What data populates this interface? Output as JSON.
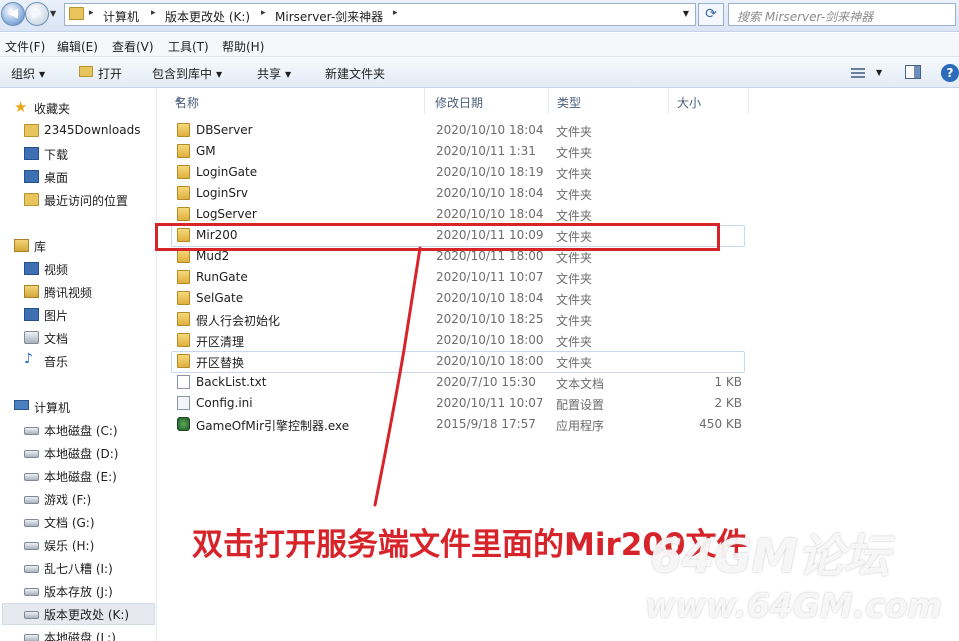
{
  "address_bar": {
    "crumbs": [
      "计算机",
      "版本更改处 (K:)",
      "Mirserver-剑来神器"
    ],
    "search_placeholder": "搜索 Mirserver-剑来神器"
  },
  "menu": {
    "items": [
      "文件(F)",
      "编辑(E)",
      "查看(V)",
      "工具(T)",
      "帮助(H)"
    ]
  },
  "toolbar": {
    "organize": "组织",
    "open": "打开",
    "include_library": "包含到库中",
    "share": "共享",
    "new_folder": "新建文件夹"
  },
  "nav": {
    "favorites_header": "收藏夹",
    "favorites": [
      "2345Downloads",
      "下载",
      "桌面",
      "最近访问的位置"
    ],
    "libraries_header": "库",
    "libraries": [
      "视频",
      "腾讯视频",
      "图片",
      "文档",
      "音乐"
    ],
    "computer_header": "计算机",
    "drives": [
      "本地磁盘 (C:)",
      "本地磁盘 (D:)",
      "本地磁盘 (E:)",
      "游戏 (F:)",
      "文档 (G:)",
      "娱乐 (H:)",
      "乱七八糟 (I:)",
      "版本存放 (J:)",
      "版本更改处 (K:)",
      "本地磁盘 (L:)"
    ]
  },
  "columns": {
    "name": "名称",
    "modified": "修改日期",
    "type": "类型",
    "size": "大小"
  },
  "files": [
    {
      "name": "DBServer",
      "date": "2020/10/10 18:04",
      "type": "文件夹",
      "size": "",
      "kind": "folder"
    },
    {
      "name": "GM",
      "date": "2020/10/11 1:31",
      "type": "文件夹",
      "size": "",
      "kind": "folder"
    },
    {
      "name": "LoginGate",
      "date": "2020/10/10 18:19",
      "type": "文件夹",
      "size": "",
      "kind": "folder"
    },
    {
      "name": "LoginSrv",
      "date": "2020/10/10 18:04",
      "type": "文件夹",
      "size": "",
      "kind": "folder"
    },
    {
      "name": "LogServer",
      "date": "2020/10/10 18:04",
      "type": "文件夹",
      "size": "",
      "kind": "folder"
    },
    {
      "name": "Mir200",
      "date": "2020/10/11 10:09",
      "type": "文件夹",
      "size": "",
      "kind": "folder"
    },
    {
      "name": "Mud2",
      "date": "2020/10/11 18:00",
      "type": "文件夹",
      "size": "",
      "kind": "folder"
    },
    {
      "name": "RunGate",
      "date": "2020/10/11 10:07",
      "type": "文件夹",
      "size": "",
      "kind": "folder"
    },
    {
      "name": "SelGate",
      "date": "2020/10/10 18:04",
      "type": "文件夹",
      "size": "",
      "kind": "folder"
    },
    {
      "name": "假人行会初始化",
      "date": "2020/10/10 18:25",
      "type": "文件夹",
      "size": "",
      "kind": "folder"
    },
    {
      "name": "开区清理",
      "date": "2020/10/10 18:00",
      "type": "文件夹",
      "size": "",
      "kind": "folder"
    },
    {
      "name": "开区替换",
      "date": "2020/10/10 18:00",
      "type": "文件夹",
      "size": "",
      "kind": "folder"
    },
    {
      "name": "BackList.txt",
      "date": "2020/7/10 15:30",
      "type": "文本文档",
      "size": "1 KB",
      "kind": "txt"
    },
    {
      "name": "Config.ini",
      "date": "2020/10/11 10:07",
      "type": "配置设置",
      "size": "2 KB",
      "kind": "ini"
    },
    {
      "name": "GameOfMir引擎控制器.exe",
      "date": "2015/9/18 17:57",
      "type": "应用程序",
      "size": "450 KB",
      "kind": "exe"
    }
  ],
  "annotation": {
    "caption": "双击打开服务端文件里面的Mir200文件",
    "color": "#d7242b"
  },
  "watermark": {
    "line1": "64GM论坛",
    "line2": "www.64GM.com"
  }
}
